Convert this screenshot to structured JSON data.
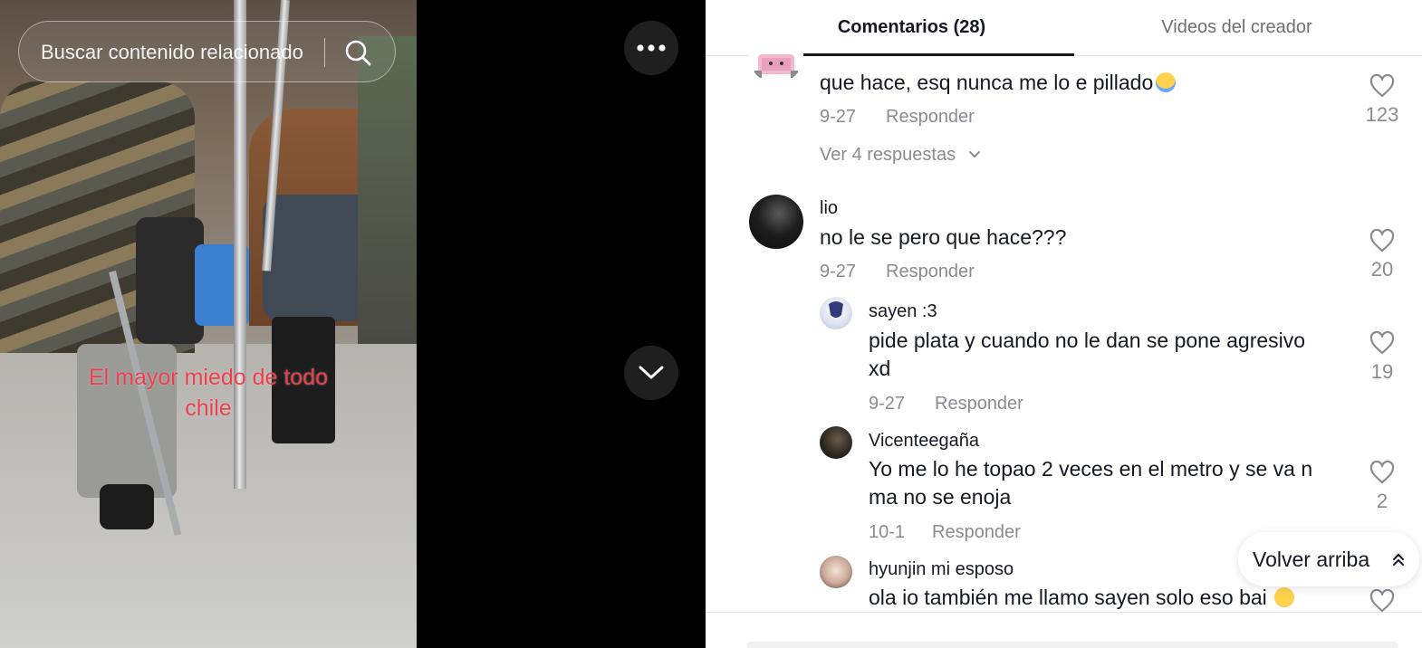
{
  "video": {
    "search_text": "Buscar contenido relacionado",
    "caption_line1": "El mayor miedo de todo",
    "caption_line2": "chile",
    "more_icon": "more-horizontal-icon",
    "down_icon": "chevron-down-icon"
  },
  "tabs": {
    "comments": "Comentarios (28)",
    "creator_videos": "Videos del creador"
  },
  "comments": [
    {
      "text": "que hace, esq nunca me lo e pillado",
      "date": "9-27",
      "reply": "Responder",
      "likes": "123",
      "view_replies": "Ver 4 respuestas"
    },
    {
      "username": "lio",
      "text": "no le se pero que hace???",
      "date": "9-27",
      "reply": "Responder",
      "likes": "20"
    }
  ],
  "replies": [
    {
      "username": "sayen :3",
      "text_line1": "pide plata y cuando no le dan se pone agresivo",
      "text_line2": "xd",
      "date": "9-27",
      "reply": "Responder",
      "likes": "19"
    },
    {
      "username": "Vicenteegaña",
      "text_line1": "Yo me lo he topao 2 veces en el metro y se va n",
      "text_line2": "ma no se enoja",
      "date": "10-1",
      "reply": "Responder",
      "likes": "2"
    },
    {
      "username": "hyunjin mi esposo",
      "text_line1": "ola io también me llamo sayen solo eso bai"
    }
  ],
  "back_to_top": "Volver arriba",
  "colors": {
    "caption": "#ee3f4d",
    "text": "#161823",
    "muted": "#8a8b91"
  }
}
